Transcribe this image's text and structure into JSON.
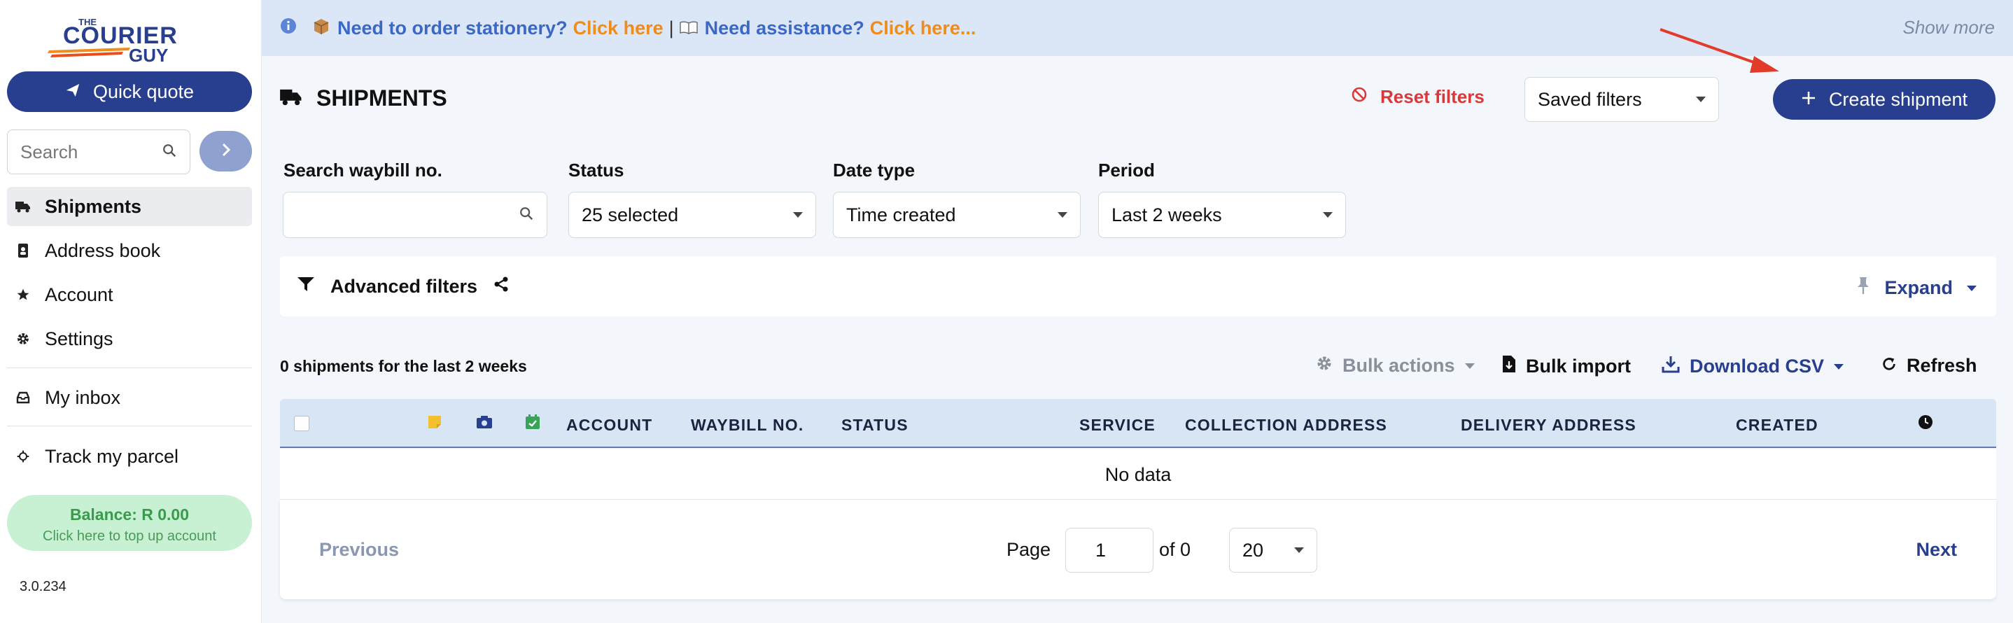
{
  "logo": {
    "text_top": "THE",
    "text_main": "COURIER",
    "text_sub": "GUY"
  },
  "sidebar": {
    "quick_quote": "Quick quote",
    "search_placeholder": "Search",
    "items": [
      {
        "label": "Shipments",
        "icon": "truck-icon"
      },
      {
        "label": "Address book",
        "icon": "address-book-icon"
      },
      {
        "label": "Account",
        "icon": "star-icon"
      },
      {
        "label": "Settings",
        "icon": "gear-icon"
      },
      {
        "label": "My inbox",
        "icon": "inbox-icon"
      },
      {
        "label": "Track my parcel",
        "icon": "crosshair-icon"
      }
    ],
    "balance": "Balance: R 0.00",
    "topup": "Click here to top up account",
    "version": "3.0.234"
  },
  "banner": {
    "q1": "Need to order stationery?",
    "link1": "Click here",
    "sep": "|",
    "q2": "Need assistance?",
    "link2": "Click here...",
    "show_more": "Show more"
  },
  "header": {
    "title": "SHIPMENTS",
    "reset": "Reset filters",
    "saved": "Saved filters",
    "create": "Create shipment"
  },
  "filters": {
    "waybill_label": "Search waybill no.",
    "waybill_value": "",
    "status_label": "Status",
    "status_value": "25 selected",
    "datetype_label": "Date type",
    "datetype_value": "Time created",
    "period_label": "Period",
    "period_value": "Last 2 weeks",
    "advanced": "Advanced filters",
    "expand": "Expand"
  },
  "toolbar": {
    "count": "0 shipments for the last 2 weeks",
    "bulk_actions": "Bulk actions",
    "bulk_import": "Bulk import",
    "download": "Download CSV",
    "refresh": "Refresh"
  },
  "table": {
    "columns": [
      "ACCOUNT",
      "WAYBILL NO.",
      "STATUS",
      "SERVICE",
      "COLLECTION ADDRESS",
      "DELIVERY ADDRESS",
      "CREATED"
    ],
    "no_data": "No data"
  },
  "pagination": {
    "previous": "Previous",
    "page_label": "Page",
    "page": "1",
    "of": "of 0",
    "page_size": "20",
    "next": "Next"
  },
  "colors": {
    "primary": "#283e8e",
    "danger": "#d9393b",
    "banner": "#dbe6f7",
    "link_orange": "#f08c1a"
  }
}
